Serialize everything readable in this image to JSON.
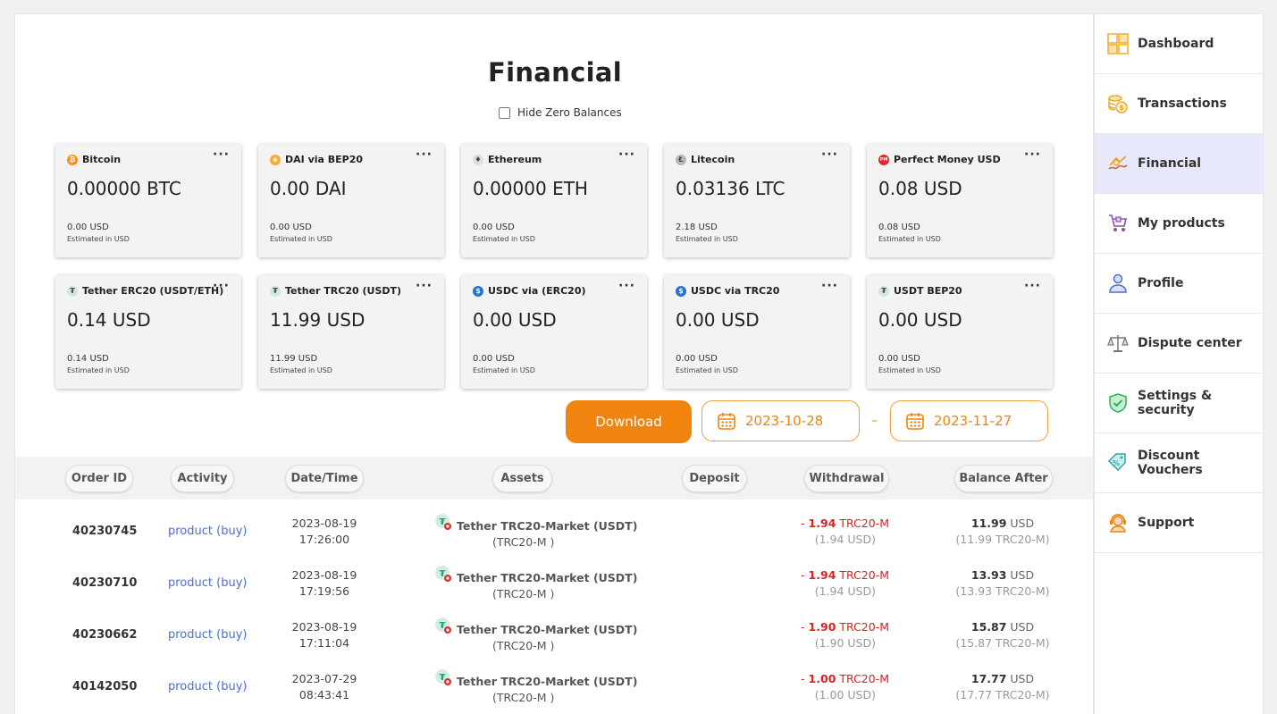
{
  "page": {
    "title": "Financial",
    "hide_zero_label": "Hide Zero Balances"
  },
  "cards": [
    {
      "name": "Bitcoin",
      "amount": "0.00000 BTC",
      "usd": "0.00 USD",
      "est": "Estimated in USD",
      "icon": "bitcoin-icon",
      "color": "#f7931a",
      "glyph": "₿"
    },
    {
      "name": "DAI via BEP20",
      "amount": "0.00 DAI",
      "usd": "0.00 USD",
      "est": "Estimated in USD",
      "icon": "dai-icon",
      "color": "#f5ac37",
      "glyph": "◈"
    },
    {
      "name": "Ethereum",
      "amount": "0.00000 ETH",
      "usd": "0.00 USD",
      "est": "Estimated in USD",
      "icon": "ethereum-icon",
      "color": "#dddddd",
      "glyph": "♦"
    },
    {
      "name": "Litecoin",
      "amount": "0.03136 LTC",
      "usd": "2.18 USD",
      "est": "Estimated in USD",
      "icon": "litecoin-icon",
      "color": "#b8b8b8",
      "glyph": "Ł"
    },
    {
      "name": "Perfect Money USD",
      "amount": "0.08 USD",
      "usd": "0.08 USD",
      "est": "Estimated in USD",
      "icon": "perfect-money-icon",
      "color": "#e0282b",
      "glyph": "PM"
    },
    {
      "name": "Tether ERC20 (USDT/ETH)",
      "amount": "0.14 USD",
      "usd": "0.14 USD",
      "est": "Estimated in USD",
      "icon": "tether-icon",
      "color": "#cfe9e0",
      "glyph": "₮"
    },
    {
      "name": "Tether TRC20 (USDT)",
      "amount": "11.99 USD",
      "usd": "11.99 USD",
      "est": "Estimated in USD",
      "icon": "tether-icon",
      "color": "#cfe9e0",
      "glyph": "₮"
    },
    {
      "name": "USDC via (ERC20)",
      "amount": "0.00 USD",
      "usd": "0.00 USD",
      "est": "Estimated in USD",
      "icon": "usdc-icon",
      "color": "#2775ca",
      "glyph": "$"
    },
    {
      "name": "USDC via TRC20",
      "amount": "0.00 USD",
      "usd": "0.00 USD",
      "est": "Estimated in USD",
      "icon": "usdc-icon",
      "color": "#2775ca",
      "glyph": "$"
    },
    {
      "name": "USDT BEP20",
      "amount": "0.00 USD",
      "usd": "0.00 USD",
      "est": "Estimated in USD",
      "icon": "tether-icon",
      "color": "#cfe9e0",
      "glyph": "₮"
    }
  ],
  "toolbar": {
    "download_label": "Download",
    "date_from": "2023-10-28",
    "date_to": "2023-11-27",
    "separator": "–"
  },
  "table": {
    "headers": [
      "Order ID",
      "Activity",
      "Date/Time",
      "Assets",
      "Deposit",
      "Withdrawal",
      "Balance After"
    ],
    "rows": [
      {
        "order_id": "40230745",
        "activity": "product (buy)",
        "date": "2023-08-19",
        "time": "17:26:00",
        "asset": "Tether TRC20-Market (USDT)",
        "asset_sub": "(TRC20-M )",
        "wd_sign": "- ",
        "wd_amount": "1.94",
        "wd_unit": " TRC20-M",
        "wd_usd": "(1.94 USD)",
        "bal_amount": "11.99",
        "bal_unit": " USD",
        "bal_sub": "(11.99 TRC20-M)"
      },
      {
        "order_id": "40230710",
        "activity": "product (buy)",
        "date": "2023-08-19",
        "time": "17:19:56",
        "asset": "Tether TRC20-Market (USDT)",
        "asset_sub": "(TRC20-M )",
        "wd_sign": "- ",
        "wd_amount": "1.94",
        "wd_unit": " TRC20-M",
        "wd_usd": "(1.94 USD)",
        "bal_amount": "13.93",
        "bal_unit": " USD",
        "bal_sub": "(13.93 TRC20-M)"
      },
      {
        "order_id": "40230662",
        "activity": "product (buy)",
        "date": "2023-08-19",
        "time": "17:11:04",
        "asset": "Tether TRC20-Market (USDT)",
        "asset_sub": "(TRC20-M )",
        "wd_sign": "- ",
        "wd_amount": "1.90",
        "wd_unit": " TRC20-M",
        "wd_usd": "(1.90 USD)",
        "bal_amount": "15.87",
        "bal_unit": " USD",
        "bal_sub": "(15.87 TRC20-M)"
      },
      {
        "order_id": "40142050",
        "activity": "product (buy)",
        "date": "2023-07-29",
        "time": "08:43:41",
        "asset": "Tether TRC20-Market (USDT)",
        "asset_sub": "(TRC20-M )",
        "wd_sign": "- ",
        "wd_amount": "1.00",
        "wd_unit": " TRC20-M",
        "wd_usd": "(1.00 USD)",
        "bal_amount": "17.77",
        "bal_unit": " USD",
        "bal_sub": "(17.77 TRC20-M)"
      }
    ]
  },
  "sidebar": {
    "items": [
      {
        "label": "Dashboard",
        "icon": "dashboard-icon",
        "active": false
      },
      {
        "label": "Transactions",
        "icon": "coins-icon",
        "active": false
      },
      {
        "label": "Financial",
        "icon": "financial-icon",
        "active": true
      },
      {
        "label": "My products",
        "icon": "cart-icon",
        "active": false
      },
      {
        "label": "Profile",
        "icon": "profile-icon",
        "active": false
      },
      {
        "label": "Dispute center",
        "icon": "scales-icon",
        "active": false
      },
      {
        "label": "Settings & security",
        "icon": "shield-icon",
        "active": false
      },
      {
        "label": "Discount Vouchers",
        "icon": "voucher-icon",
        "active": false
      },
      {
        "label": "Support",
        "icon": "support-icon",
        "active": false
      }
    ]
  },
  "colors": {
    "accent": "#f0840f",
    "link": "#4a6fd0",
    "negative": "#e02020",
    "active_nav": "#e8e8fb"
  }
}
